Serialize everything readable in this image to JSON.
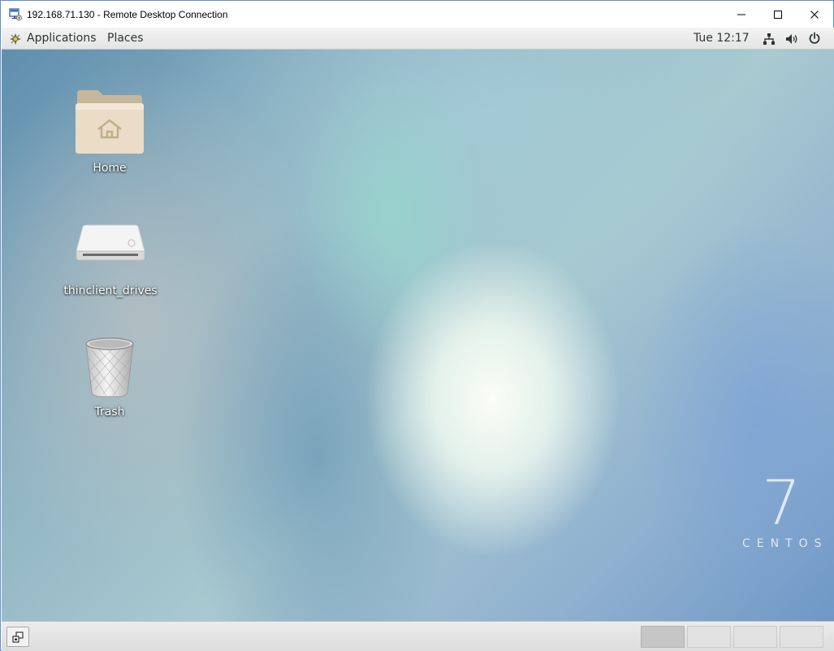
{
  "window": {
    "title": "192.168.71.130 - Remote Desktop Connection",
    "icon": "remote-desktop-icon",
    "controls": [
      "minimize-icon",
      "maximize-icon",
      "close-icon"
    ]
  },
  "top_panel": {
    "applications_label": "Applications",
    "places_label": "Places",
    "clock": "Tue 12:17",
    "status_icons": [
      "network-icon",
      "volume-icon",
      "power-icon"
    ]
  },
  "desktop": {
    "icons": [
      {
        "label": "Home",
        "icon": "home-folder-icon"
      },
      {
        "label": "thinclient_drives",
        "icon": "drive-icon"
      },
      {
        "label": "Trash",
        "icon": "trash-icon"
      }
    ],
    "branding": {
      "number": "7",
      "word": "CENTOS"
    }
  },
  "bottom_panel": {
    "show_desktop_icon": "show-desktop-icon",
    "workspaces": [
      {
        "active": true
      },
      {
        "active": false
      },
      {
        "active": false
      },
      {
        "active": false
      }
    ]
  }
}
